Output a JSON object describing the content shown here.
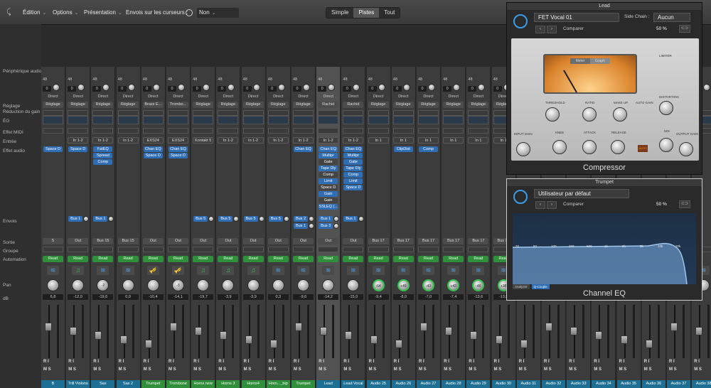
{
  "toolbar": {
    "edit": "Édition",
    "options": "Options",
    "presentation": "Présentation",
    "sends_on_faders": "Envois sur les curseurs :",
    "sends_value": "Non",
    "view_modes": [
      "Simple",
      "Pistes",
      "Tout"
    ],
    "active_view": "Pistes"
  },
  "row_labels": {
    "audio_device": "Périphérique audio",
    "setting": "Réglage",
    "gain_reduction": "Réduction du gain",
    "eq": "ÉG",
    "midi_fx": "Effet MIDI",
    "input": "Entrée",
    "audio_fx": "Effet audio",
    "sends": "Envois",
    "output": "Sortie",
    "group": "Groupe",
    "automation": "Automation",
    "pan": "Pan",
    "db": "dB"
  },
  "strip_common": {
    "direct": "Direct",
    "setting_btn": "Réglage",
    "read": "Read",
    "ri": "R I",
    "ms": "M S",
    "rate": "48"
  },
  "strips": [
    {
      "name": "B",
      "input": "",
      "fx": [
        "Space D"
      ],
      "sends": [],
      "out": "5",
      "pan": "",
      "db": "6,8",
      "name_color": "blue",
      "icon": "wave"
    },
    {
      "name": "Trill Violons",
      "input": "In 1-2",
      "fx": [
        "Space D"
      ],
      "sends": [
        "Bus 1"
      ],
      "out": "Out",
      "pan": "",
      "db": "-12,0",
      "name_color": "blue",
      "icon": "note",
      "setting": "Réglage"
    },
    {
      "name": "Sax",
      "input": "In 1-2",
      "fx": [
        "FatEQ",
        "Spread",
        "Comp"
      ],
      "sends": [
        "Bus 1"
      ],
      "out": "Bus 15",
      "pan": "-2",
      "db": "-19,6",
      "name_color": "blue",
      "icon": "wave",
      "setting": "Réglage"
    },
    {
      "name": "Sax 2",
      "input": "In 1-2",
      "fx": [],
      "sends": [],
      "out": "Bus 15",
      "pan": "",
      "db": "0,0",
      "name_color": "blue",
      "icon": "wave",
      "setting": "Réglage"
    },
    {
      "name": "Trumpet",
      "input": "EXS24",
      "fx": [
        "Chan EQ",
        "Space D"
      ],
      "sends": [],
      "out": "Out",
      "pan": "",
      "db": "-10,4",
      "name_color": "green",
      "icon": "trumpet",
      "setting": "Brass E..."
    },
    {
      "name": "Trombone",
      "input": "EXS24",
      "fx": [
        "Chan EQ",
        "Space D"
      ],
      "sends": [],
      "out": "Out",
      "pan": "-3",
      "db": "-14,1",
      "name_color": "green",
      "icon": "trumpet",
      "setting": "Trombo..."
    },
    {
      "name": "Horns new",
      "input": "Kontakt 5",
      "fx": [],
      "sends": [
        "Bus 5"
      ],
      "out": "Out",
      "pan": "",
      "db": "-19,7",
      "name_color": "green",
      "icon": "note"
    },
    {
      "name": "Horns 3",
      "input": "In 1-2",
      "fx": [],
      "sends": [
        "Bus 5"
      ],
      "out": "Out",
      "pan": "",
      "db": "-3,9",
      "name_color": "green",
      "icon": "note",
      "setting": "Réglage"
    },
    {
      "name": "Horns4",
      "input": "In 1-2",
      "fx": [],
      "sends": [
        "Bus 5"
      ],
      "out": "Out",
      "pan": "",
      "db": "-3,9",
      "name_color": "green",
      "icon": "note",
      "setting": "Réglage"
    },
    {
      "name": "Horn..._bip",
      "input": "In 1-2",
      "fx": [],
      "sends": [
        "Bus 5"
      ],
      "out": "Out",
      "pan": "",
      "db": "0,3",
      "name_color": "green",
      "icon": "wave",
      "setting": "Réglage"
    },
    {
      "name": "Trumpet",
      "input": "In 1-2",
      "fx": [
        "Chan EQ"
      ],
      "sends": [
        "Bus 2",
        "Bus 1"
      ],
      "out": "Out",
      "pan": "",
      "db": "-9,6",
      "name_color": "green",
      "icon": "wave",
      "setting": "Réglage"
    },
    {
      "name": "Lead",
      "input": "In 1-2",
      "fx": [
        "Chan EQ",
        "Multipr",
        "Gate",
        "Tape Dly",
        "Comp",
        "Limit",
        "Space D",
        "Gain",
        "Gain",
        "SSLEQ (..."
      ],
      "sends": [
        "Bus 1",
        "Bus 3"
      ],
      "out": "Out",
      "pan": "",
      "db": "-14,2",
      "name_color": "blue",
      "icon": "wave",
      "setting": "Rachid",
      "selected": true
    },
    {
      "name": "Lead Vocal",
      "input": "In 1-2",
      "fx": [
        "Chan EQ",
        "Multipr",
        "Gate",
        "Tape Dly",
        "Comp",
        "Limit",
        "Space D"
      ],
      "sends": [
        "Bus 1"
      ],
      "out": "Out",
      "pan": "",
      "db": "-15,0",
      "name_color": "blue",
      "icon": "wave",
      "setting": "Rachid"
    },
    {
      "name": "Audio 25",
      "input": "In 1",
      "fx": [],
      "sends": [],
      "out": "Bus 17",
      "pan": "-64",
      "db": "-9,4",
      "name_color": "blue",
      "icon": "wave",
      "setting": "Réglage"
    },
    {
      "name": "Audio 26",
      "input": "In 1",
      "fx": [
        "ClipDist"
      ],
      "sends": [],
      "out": "Bus 17",
      "pan": "+49",
      "db": "-8,0",
      "name_color": "blue",
      "icon": "wave",
      "setting": "Réglage"
    },
    {
      "name": "Audio 27",
      "input": "In 1",
      "fx": [
        "Comp"
      ],
      "sends": [],
      "out": "Bus 17",
      "pan": "-43",
      "db": "-7,0",
      "name_color": "blue",
      "icon": "wave",
      "setting": "Réglage"
    },
    {
      "name": "Audio 28",
      "input": "In 1",
      "fx": [],
      "sends": [],
      "out": "Bus 17",
      "pan": "+43",
      "db": "-7,4",
      "name_color": "blue",
      "icon": "wave",
      "setting": "Réglage"
    },
    {
      "name": "Audio 29",
      "input": "In 1",
      "fx": [],
      "sends": [],
      "out": "Bus 17",
      "pan": "-46",
      "db": "-13,6",
      "name_color": "blue",
      "icon": "wave",
      "setting": "Réglage"
    },
    {
      "name": "Audio 30",
      "input": "In 1",
      "fx": [],
      "sends": [],
      "out": "Bus 17",
      "pan": "+38",
      "db": "-13,5",
      "name_color": "blue",
      "icon": "wave",
      "setting": "Réglage"
    },
    {
      "name": "Audio 31",
      "input": "",
      "fx": [],
      "sends": [],
      "out": "",
      "pan": "",
      "db": "",
      "name_color": "blue",
      "icon": "wave"
    },
    {
      "name": "Audio 32",
      "input": "",
      "fx": [],
      "sends": [],
      "out": "",
      "pan": "",
      "db": "",
      "name_color": "blue",
      "icon": "wave"
    },
    {
      "name": "Audio 33",
      "input": "",
      "fx": [],
      "sends": [],
      "out": "",
      "pan": "",
      "db": "",
      "name_color": "blue",
      "icon": "wave"
    },
    {
      "name": "Audio 34",
      "input": "",
      "fx": [],
      "sends": [],
      "out": "",
      "pan": "",
      "db": "",
      "name_color": "blue",
      "icon": "wave"
    },
    {
      "name": "Audio 35",
      "input": "",
      "fx": [],
      "sends": [],
      "out": "",
      "pan": "",
      "db": "",
      "name_color": "blue",
      "icon": "wave"
    },
    {
      "name": "Audio 36",
      "input": "",
      "fx": [],
      "sends": [],
      "out": "",
      "pan": "",
      "db": "",
      "name_color": "blue",
      "icon": "wave"
    },
    {
      "name": "Audio 37",
      "input": "",
      "fx": [],
      "sends": [],
      "out": "",
      "pan": "",
      "db": "",
      "name_color": "blue",
      "icon": "wave"
    },
    {
      "name": "Audio 38",
      "input": "",
      "fx": [],
      "sends": [],
      "out": "",
      "pan": "",
      "db": "",
      "name_color": "blue",
      "icon": "wave"
    }
  ],
  "compressor_window": {
    "title": "Lead",
    "preset": "FET Vocal 01",
    "side_chain_label": "Side Chain :",
    "side_chain_value": "Aucun",
    "compare": "Comparer",
    "mix": "50 %",
    "plugin_name": "Compressor",
    "meter_tabs": [
      "Meter",
      "Graph"
    ],
    "labels": {
      "threshold": "THRESHOLD",
      "ratio": "RATIO",
      "makeup": "MAKE UP",
      "auto_gain": "AUTO GAIN",
      "knee": "KNEE",
      "attack": "ATTACK",
      "release": "RELEASE",
      "input_gain": "INPUT GAIN",
      "output_gain": "OUTPUT GAIN",
      "limiter": "LIMITER",
      "distortion": "DISTORTION",
      "mix": "MIX",
      "auto": "AUTO"
    }
  },
  "eq_window": {
    "title": "Trumpet",
    "preset": "Utilisateur par défaut",
    "compare": "Comparer",
    "mix": "50 %",
    "plugin_name": "Channel EQ",
    "freq_labels": [
      "20",
      "50",
      "100",
      "200",
      "500",
      "1k",
      "2k",
      "5k",
      "10k",
      "20k"
    ],
    "buttons": [
      "Analyzer",
      "Q-Couple"
    ]
  },
  "colors": {
    "accent_blue": "#3a9ce8",
    "read_green": "#2f8f3a",
    "name_blue": "#1e6f94",
    "fx_blue": "#2f6db5"
  }
}
